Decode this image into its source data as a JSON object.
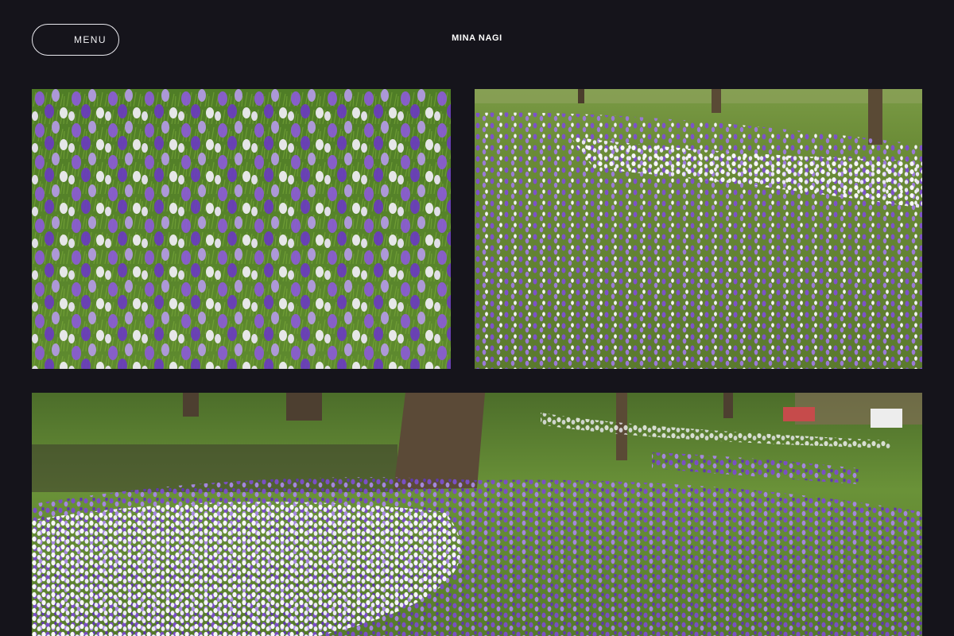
{
  "header": {
    "menu_label": "MENU",
    "site_title": "MINA NAGI"
  },
  "gallery": {
    "photos": [
      {
        "subject": "crocus-closeup",
        "palette": {
          "grass": "#5f8a2f",
          "purple": "#8a5bd1",
          "white": "#f3f1f7"
        }
      },
      {
        "subject": "crocus-meadow-with-trees",
        "palette": {
          "grass": "#6f8f3c",
          "purple": "#7d52c9",
          "white": "#f5f5f7"
        }
      },
      {
        "subject": "crocus-park-wide",
        "palette": {
          "grass": "#6a9238",
          "purple": "#7a4fc4",
          "white": "#f6f6f8"
        }
      }
    ]
  },
  "colors": {
    "background": "#15141b",
    "text": "#ffffff"
  }
}
